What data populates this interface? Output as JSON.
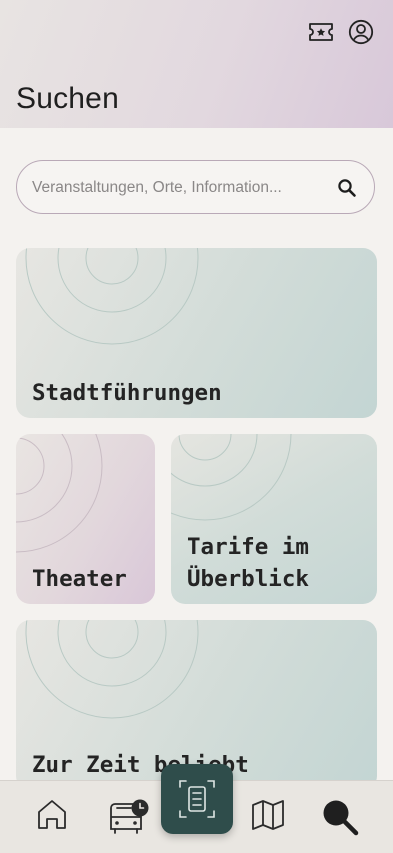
{
  "header": {
    "title": "Suchen",
    "ticket_icon": "ticket-star-icon",
    "profile_icon": "user-circle-icon"
  },
  "search": {
    "placeholder": "Veranstaltungen, Orte, Information...",
    "icon": "search-icon"
  },
  "cards": {
    "tours": "Stadtführungen",
    "theater": "Theater",
    "fares": "Tarife im\nÜberblick",
    "popular": "Zur Zeit beliebt"
  },
  "nav": {
    "items": [
      "home-icon",
      "bus-schedule-icon",
      "scan-ticket-icon",
      "map-icon",
      "search-icon"
    ],
    "active": "search-icon"
  },
  "colors": {
    "accent": "#2f4d4b",
    "background": "#f4f2ef",
    "nav_background": "#e9e6e1"
  }
}
